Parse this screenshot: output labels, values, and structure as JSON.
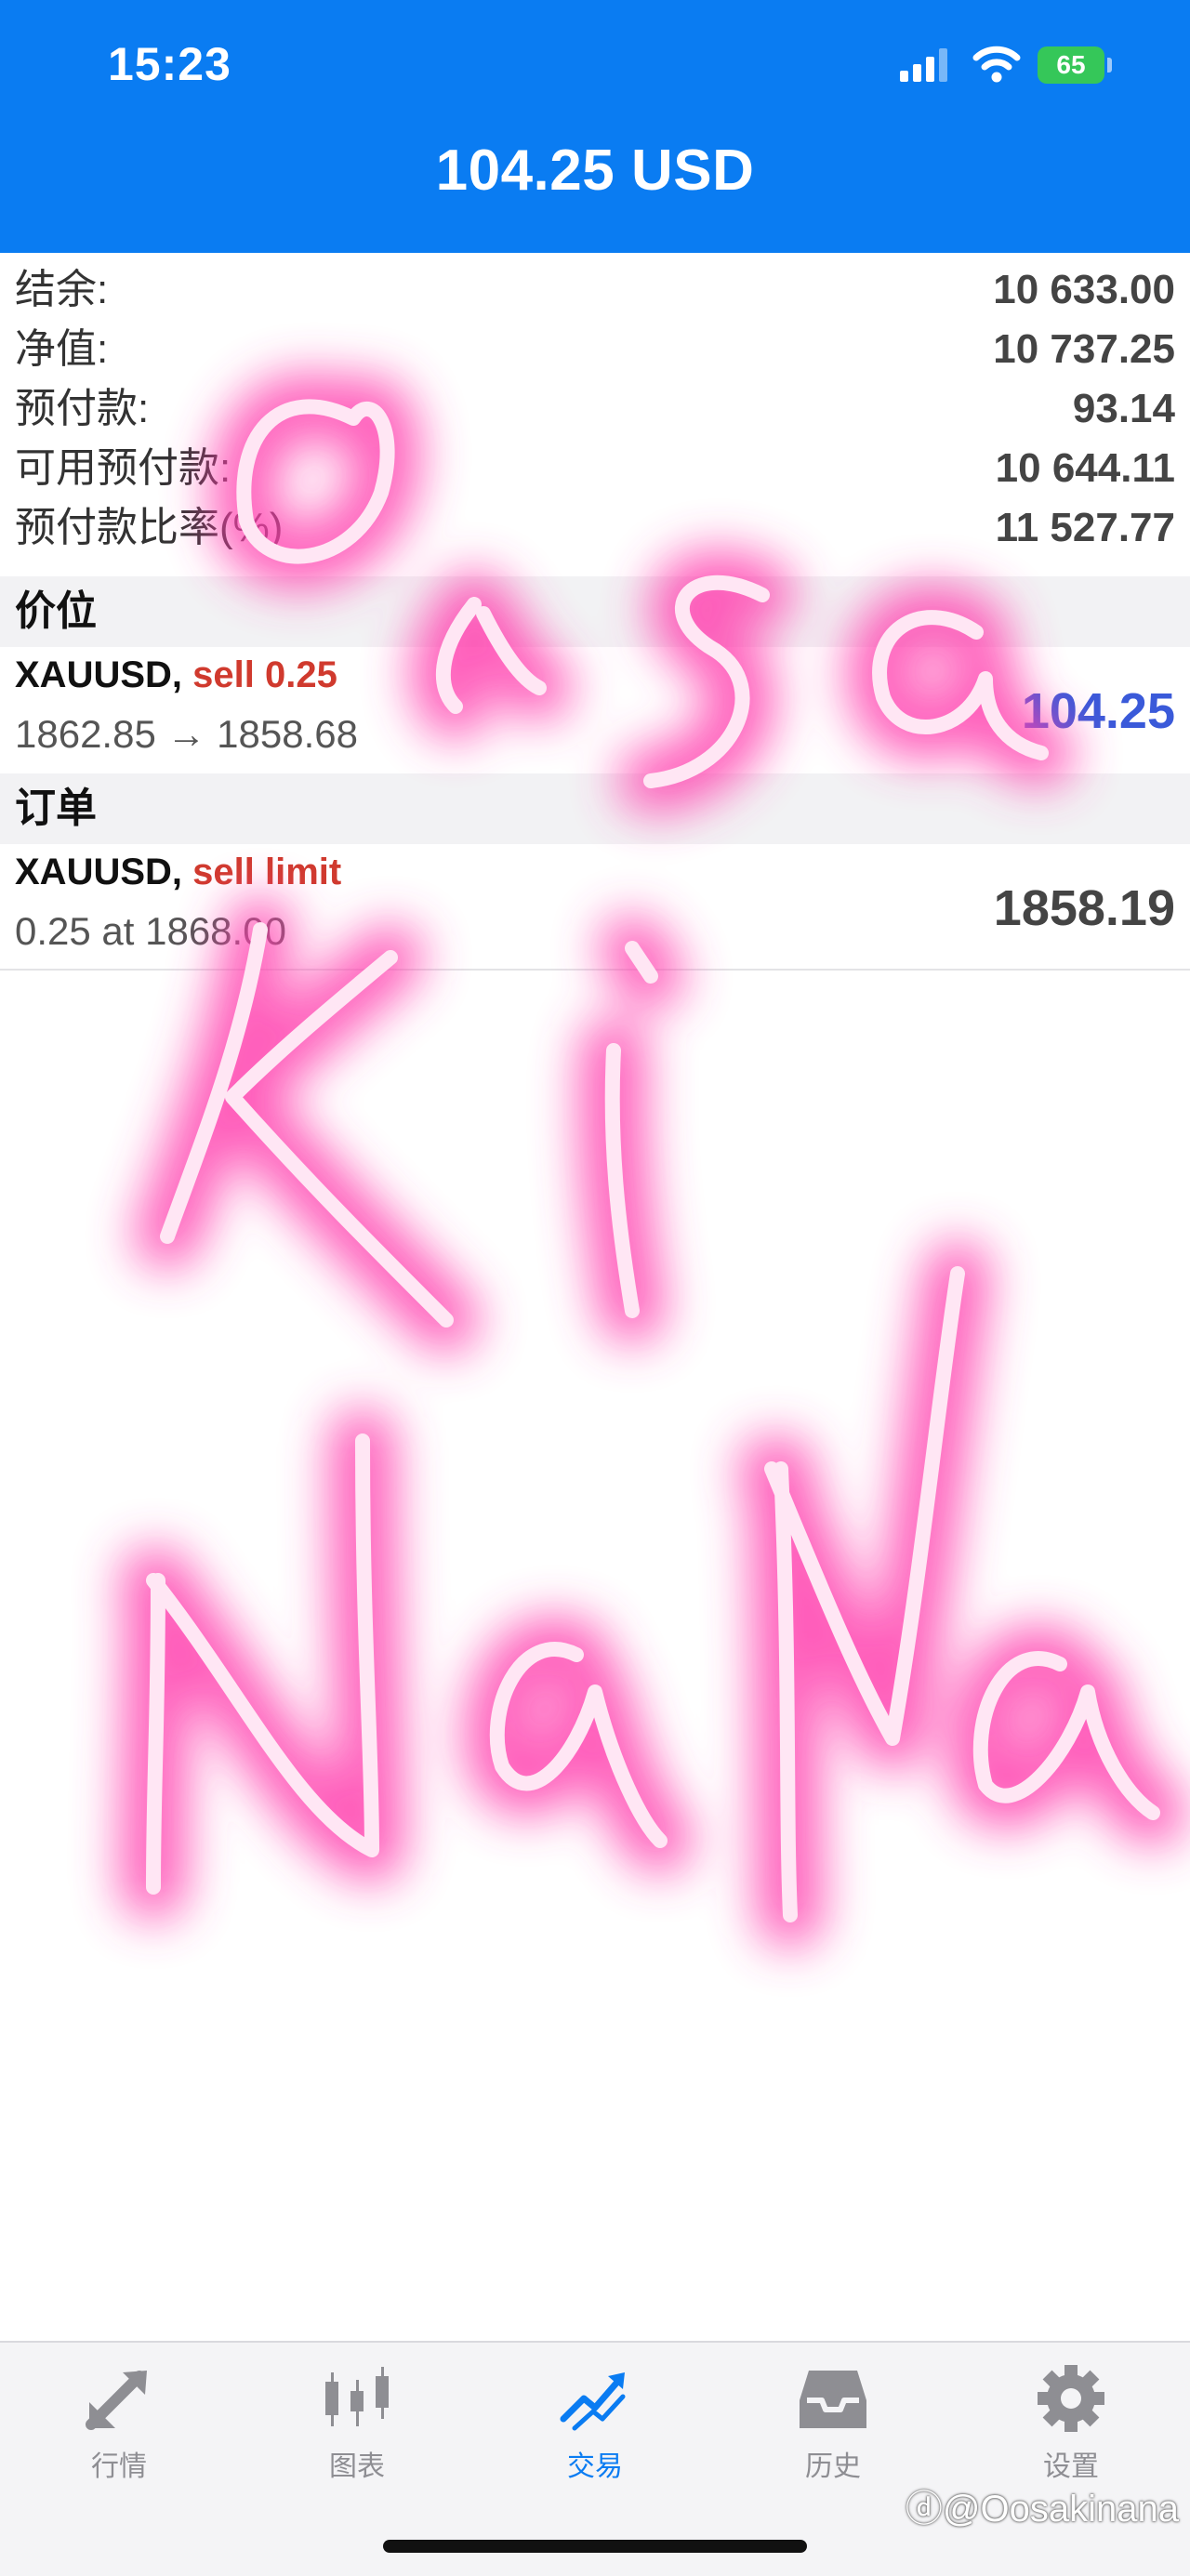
{
  "status_bar": {
    "time": "15:23",
    "battery": "65"
  },
  "header": {
    "title": "104.25 USD"
  },
  "account": [
    {
      "label": "结余:",
      "value": "10 633.00"
    },
    {
      "label": "净值:",
      "value": "10 737.25"
    },
    {
      "label": "预付款:",
      "value": "93.14"
    },
    {
      "label": "可用预付款:",
      "value": "10 644.11"
    },
    {
      "label": "预付款比率(%)",
      "value": "11 527.77"
    }
  ],
  "positions": {
    "section_title": "价位",
    "items": [
      {
        "symbol": "XAUUSD,",
        "type": "sell 0.25",
        "prices": "1862.85 → 1858.68",
        "value": "104.25",
        "value_color": "#3a5ad9"
      }
    ]
  },
  "orders": {
    "section_title": "订单",
    "items": [
      {
        "symbol": "XAUUSD,",
        "type": "sell limit",
        "detail": "0.25 at 1868.00",
        "value": "1858.19",
        "value_color": "#444444"
      }
    ]
  },
  "tabs": [
    {
      "label": "行情",
      "icon": "quotes-arrows-icon",
      "active": false
    },
    {
      "label": "图表",
      "icon": "candlestick-chart-icon",
      "active": false
    },
    {
      "label": "交易",
      "icon": "trade-trend-icon",
      "active": true
    },
    {
      "label": "历史",
      "icon": "history-inbox-icon",
      "active": false
    },
    {
      "label": "设置",
      "icon": "settings-gear-icon",
      "active": false
    }
  ],
  "watermark_credit": "ⓓ@Oosakinana",
  "colors": {
    "accent": "#0a7cf2",
    "sell": "#d03a2e",
    "profit": "#3a5ad9",
    "watermark": "#ff4fb5"
  }
}
